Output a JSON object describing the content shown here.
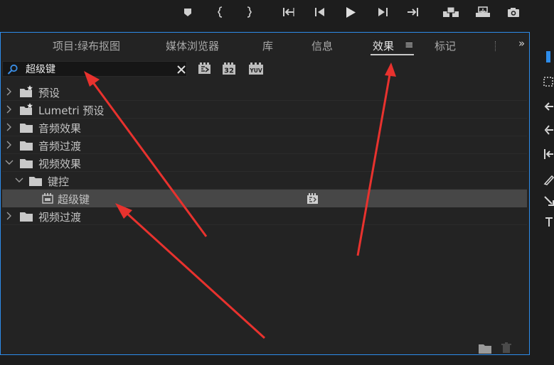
{
  "toolbar": {
    "buttons": [
      "marker-icon",
      "mark-in-icon",
      "mark-out-icon",
      "go-to-in-icon",
      "step-back-icon",
      "play-icon",
      "step-forward-icon",
      "go-to-out-icon",
      "insert-icon",
      "overwrite-icon",
      "export-frame-icon"
    ]
  },
  "tabs": [
    {
      "label": "项目:绿布抠图",
      "active": false
    },
    {
      "label": "媒体浏览器",
      "active": false
    },
    {
      "label": "库",
      "active": false
    },
    {
      "label": "信息",
      "active": false
    },
    {
      "label": "效果",
      "active": true
    },
    {
      "label": "标记",
      "active": false
    }
  ],
  "tab_menu_glyph": "≡",
  "more_glyph": "»",
  "search": {
    "value": "超级键",
    "placeholder": ""
  },
  "filters": [
    "accelerated-effects-icon",
    "32-bit-icon",
    "yuv-icon"
  ],
  "filter_labels": {
    "bit32": "32",
    "yuv": "YUV"
  },
  "tree": [
    {
      "label": "预设",
      "level": 0,
      "expanded": false,
      "icon": "preset-folder-icon"
    },
    {
      "label": "Lumetri 预设",
      "level": 0,
      "expanded": false,
      "icon": "preset-folder-icon"
    },
    {
      "label": "音频效果",
      "level": 0,
      "expanded": false,
      "icon": "folder-icon"
    },
    {
      "label": "音频过渡",
      "level": 0,
      "expanded": false,
      "icon": "folder-icon"
    },
    {
      "label": "视频效果",
      "level": 0,
      "expanded": true,
      "icon": "folder-icon"
    },
    {
      "label": "键控",
      "level": 1,
      "expanded": true,
      "icon": "folder-icon"
    },
    {
      "label": "超级键",
      "level": 2,
      "selected": true,
      "icon": "effect-icon",
      "badge": "accelerated-effects-icon"
    },
    {
      "label": "视频过渡",
      "level": 0,
      "expanded": false,
      "icon": "folder-icon"
    }
  ],
  "colors": {
    "panel_border": "#2d8ceb",
    "selection": "#474747",
    "arrow": "#e8322e"
  }
}
